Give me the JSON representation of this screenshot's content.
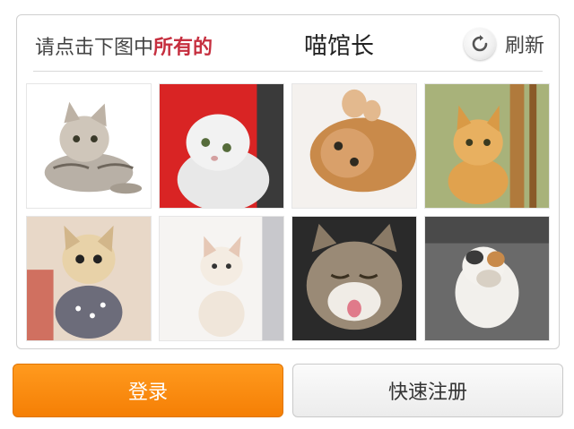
{
  "captcha": {
    "instruction_prefix": "请点击下图中",
    "instruction_emphasis": "所有的",
    "target_word": "喵馆长",
    "refresh_label": "刷新",
    "refresh_icon": "refresh-icon",
    "tiles": [
      {
        "name": "cat-image-1",
        "subject": "tabby kitten sitting"
      },
      {
        "name": "cat-image-2",
        "subject": "white scottish fold on red background"
      },
      {
        "name": "cat-image-3",
        "subject": "orange kitten lying on back"
      },
      {
        "name": "cat-image-4",
        "subject": "orange kitten by wooden post"
      },
      {
        "name": "cat-image-5",
        "subject": "kitten in grey dotted scarf"
      },
      {
        "name": "cat-image-6",
        "subject": "white kitten sitting"
      },
      {
        "name": "cat-image-7",
        "subject": "cat sticking out tongue"
      },
      {
        "name": "cat-image-8",
        "subject": "white and calico cat on pavement"
      }
    ]
  },
  "actions": {
    "login_label": "登录",
    "register_label": "快速注册"
  },
  "colors": {
    "accent": "#c62f3f",
    "login_orange": "#f57f05"
  }
}
